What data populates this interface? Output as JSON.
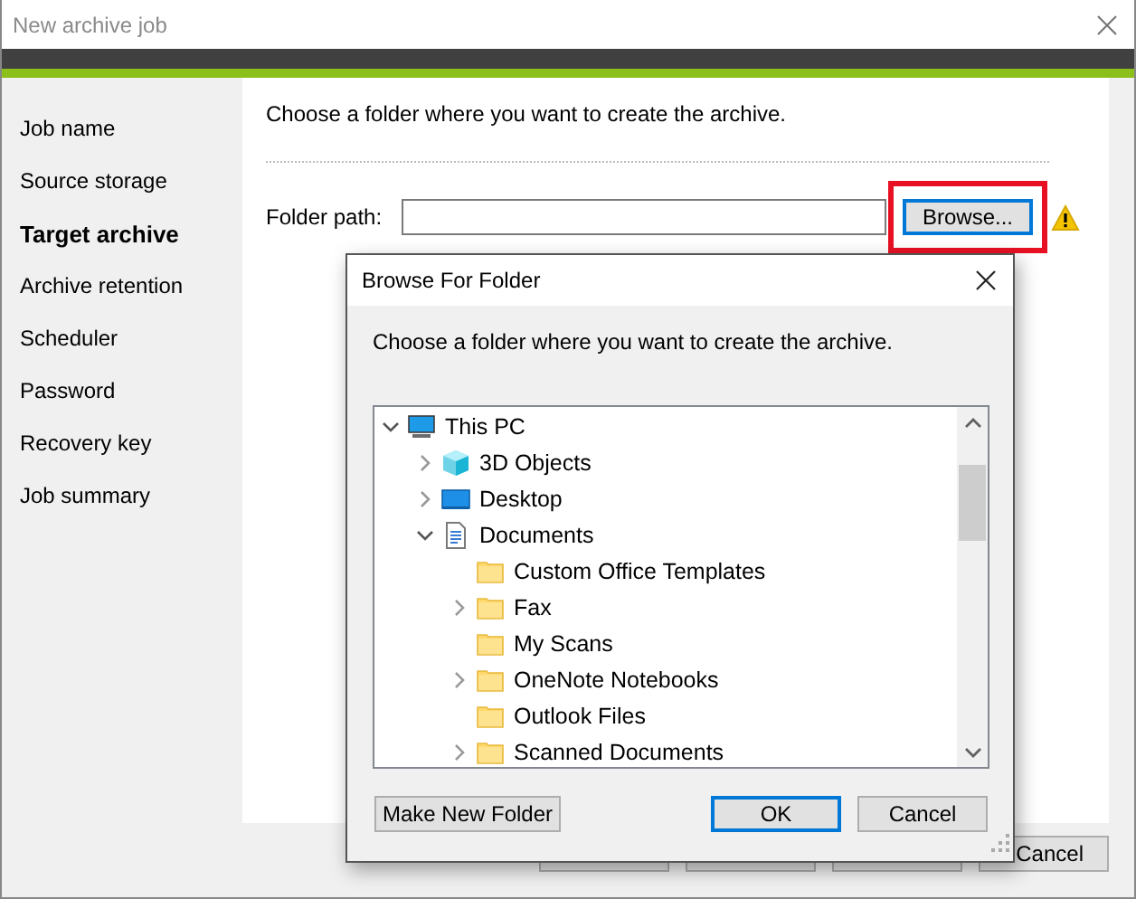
{
  "window": {
    "title": "New archive job"
  },
  "sidebar": {
    "items": [
      {
        "label": "Job name",
        "selected": false
      },
      {
        "label": "Source storage",
        "selected": false
      },
      {
        "label": "Target archive",
        "selected": true
      },
      {
        "label": "Archive retention",
        "selected": false
      },
      {
        "label": "Scheduler",
        "selected": false
      },
      {
        "label": "Password",
        "selected": false
      },
      {
        "label": "Recovery key",
        "selected": false
      },
      {
        "label": "Job summary",
        "selected": false
      }
    ]
  },
  "content": {
    "instruction": "Choose a folder where you want to create the archive.",
    "folder_path_label": "Folder path:",
    "browse_button": {
      "label": "Browse...",
      "highlighted": true
    }
  },
  "footer_buttons": [
    {
      "kind": "covered"
    },
    {
      "kind": "covered"
    },
    {
      "kind": "covered"
    },
    {
      "kind": "labeled",
      "label": "Cancel"
    }
  ],
  "dialog": {
    "title": "Browse For Folder",
    "instruction": "Choose a folder where you want to create the archive.",
    "tree": [
      {
        "label": "This PC",
        "kind": "pc",
        "expandable": true,
        "expanded": true,
        "children": [
          {
            "label": "3D Objects",
            "kind": "cube",
            "expandable": true,
            "expanded": false
          },
          {
            "label": "Desktop",
            "kind": "desktop",
            "expandable": true,
            "expanded": false
          },
          {
            "label": "Documents",
            "kind": "document",
            "expandable": true,
            "expanded": true,
            "children": [
              {
                "label": "Custom Office Templates",
                "kind": "folder",
                "expandable": false
              },
              {
                "label": "Fax",
                "kind": "folder",
                "expandable": true,
                "expanded": false
              },
              {
                "label": "My Scans",
                "kind": "folder",
                "expandable": false
              },
              {
                "label": "OneNote Notebooks",
                "kind": "folder",
                "expandable": true,
                "expanded": false
              },
              {
                "label": "Outlook Files",
                "kind": "folder",
                "expandable": false
              },
              {
                "label": "Scanned Documents",
                "kind": "folder",
                "expandable": true,
                "expanded": false
              }
            ]
          }
        ]
      }
    ],
    "buttons": [
      {
        "label": "Make New Folder",
        "default": false
      },
      {
        "label": "OK",
        "default": true
      },
      {
        "label": "Cancel",
        "default": false
      }
    ]
  }
}
